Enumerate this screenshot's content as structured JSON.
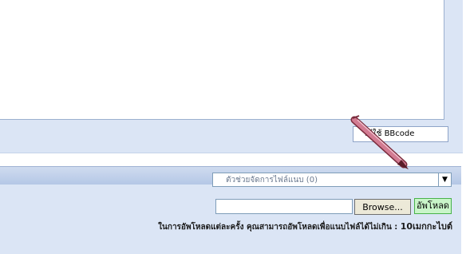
{
  "bbcode_link": {
    "label": "วิธีใช้  BBcode"
  },
  "attachments": {
    "select_text": "ตัวช่วยจัดการไฟล์แนบ  (0)",
    "browse_label": "Browse...",
    "upload_label": "อัพโหลด",
    "note_text": "ในการอัพโหลดแต่ละครั้ง คุณสามารถอัพโหลดเพื่อแนบไฟล์ได้ไม่เกิน :",
    "note_limit": "10เมกกะไบต์"
  },
  "icons": {
    "pen": "pen-icon",
    "select_arrow": "chevron-down-icon"
  },
  "colors": {
    "upload_bg": "#c9f5c9",
    "upload_border": "#49b34a",
    "panel_bg": "#dbe5f5"
  }
}
